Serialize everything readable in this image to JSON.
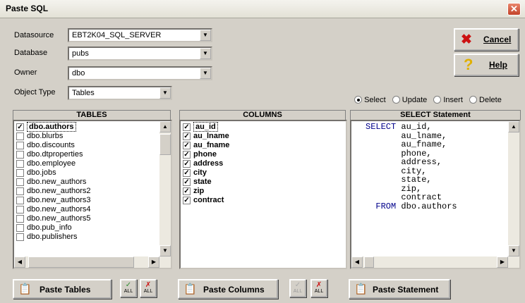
{
  "window": {
    "title": "Paste SQL"
  },
  "form": {
    "datasource_label": "Datasource",
    "datasource_value": "EBT2K04_SQL_SERVER",
    "database_label": "Database",
    "database_value": "pubs",
    "owner_label": "Owner",
    "owner_value": "dbo",
    "object_type_label": "Object Type",
    "object_type_value": "Tables"
  },
  "buttons": {
    "cancel": "Cancel",
    "help": "Help",
    "paste_tables": "Paste Tables",
    "paste_columns": "Paste Columns",
    "paste_statement": "Paste Statement",
    "all_label": "ALL"
  },
  "statement_type": {
    "options": [
      "Select",
      "Update",
      "Insert",
      "Delete"
    ],
    "selected": "Select"
  },
  "tables_panel": {
    "header": "TABLES",
    "items": [
      {
        "name": "dbo.authors",
        "checked": true
      },
      {
        "name": "dbo.blurbs",
        "checked": false
      },
      {
        "name": "dbo.discounts",
        "checked": false
      },
      {
        "name": "dbo.dtproperties",
        "checked": false
      },
      {
        "name": "dbo.employee",
        "checked": false
      },
      {
        "name": "dbo.jobs",
        "checked": false
      },
      {
        "name": "dbo.new_authors",
        "checked": false
      },
      {
        "name": "dbo.new_authors2",
        "checked": false
      },
      {
        "name": "dbo.new_authors3",
        "checked": false
      },
      {
        "name": "dbo.new_authors4",
        "checked": false
      },
      {
        "name": "dbo.new_authors5",
        "checked": false
      },
      {
        "name": "dbo.pub_info",
        "checked": false
      },
      {
        "name": "dbo.publishers",
        "checked": false
      }
    ]
  },
  "columns_panel": {
    "header": "COLUMNS",
    "items": [
      {
        "name": "au_id",
        "checked": true
      },
      {
        "name": "au_lname",
        "checked": true
      },
      {
        "name": "au_fname",
        "checked": true
      },
      {
        "name": "phone",
        "checked": true
      },
      {
        "name": "address",
        "checked": true
      },
      {
        "name": "city",
        "checked": true
      },
      {
        "name": "state",
        "checked": true
      },
      {
        "name": "zip",
        "checked": true
      },
      {
        "name": "contract",
        "checked": true
      }
    ]
  },
  "statement_panel": {
    "header": "SELECT Statement",
    "lines": [
      {
        "kw": "SELECT",
        "text": " au_id,"
      },
      {
        "kw": "",
        "text": "       au_lname,"
      },
      {
        "kw": "",
        "text": "       au_fname,"
      },
      {
        "kw": "",
        "text": "       phone,"
      },
      {
        "kw": "",
        "text": "       address,"
      },
      {
        "kw": "",
        "text": "       city,"
      },
      {
        "kw": "",
        "text": "       state,"
      },
      {
        "kw": "",
        "text": "       zip,"
      },
      {
        "kw": "",
        "text": "       contract"
      },
      {
        "kw": "  FROM",
        "text": " dbo.authors"
      }
    ]
  },
  "colors": {
    "keyword": "#00008b",
    "cancel_x": "#cc1111",
    "help_q": "#e0b000"
  },
  "icons": [
    "close-icon",
    "cancel-x-icon",
    "help-question-icon",
    "clipboard-icon",
    "check-all-icon",
    "uncheck-all-icon"
  ]
}
